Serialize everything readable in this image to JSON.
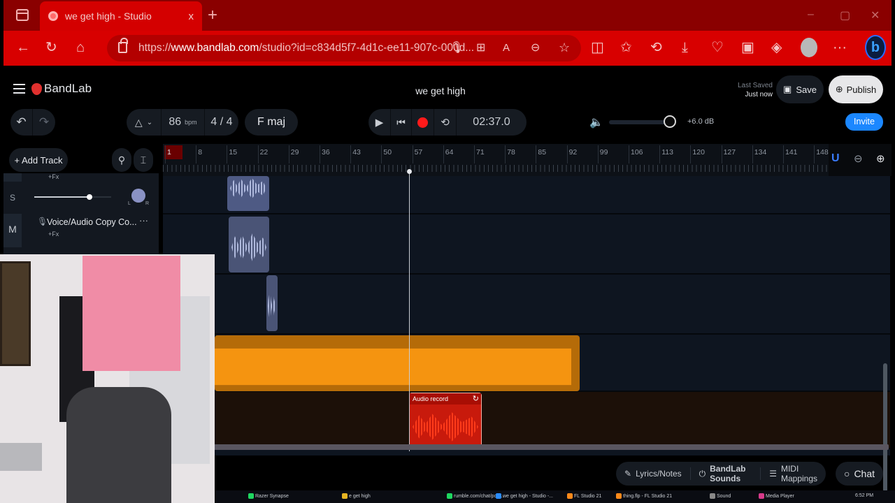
{
  "browser": {
    "tab_title": "we get high - Studio",
    "tab_close": "x",
    "new_tab": "+",
    "url_prefix": "https://",
    "url_host": "www.bandlab.com",
    "url_path": "/studio?id=c834d5f7-4d1c-ee11-907c-000d...",
    "window_controls": [
      "–",
      "▢",
      "✕"
    ],
    "nav_icons": [
      "back-icon",
      "refresh-icon",
      "home-icon"
    ],
    "toolbar_icons": [
      "microphone-icon",
      "apps-icon",
      "read-aloud-icon",
      "zoom-out-icon",
      "favorite-star-icon",
      "split-screen-icon",
      "favorites-icon",
      "history-icon",
      "downloads-icon",
      "browser-essentials-icon",
      "math-solver-icon",
      "screenshot-icon",
      "profile-avatar",
      "more-icon",
      "bing-copilot-icon"
    ]
  },
  "app": {
    "brand": "BandLab",
    "project_title": "we get high",
    "last_saved_label": "Last Saved",
    "last_saved_value": "Just now",
    "save_label": "Save",
    "publish_label": "Publish",
    "invite_label": "Invite",
    "tempo": "86",
    "tempo_unit": "bpm",
    "time_signature": "4 / 4",
    "key": "F maj",
    "time_display": "02:37.0",
    "volume_db": "+6.0 dB",
    "volume_level": 0.95,
    "add_track_label": "+ Add Track"
  },
  "ruler": {
    "bars": [
      "1",
      "8",
      "15",
      "22",
      "29",
      "36",
      "43",
      "50",
      "57",
      "64",
      "71",
      "78",
      "85",
      "92",
      "99",
      "106",
      "113",
      "120",
      "127",
      "134",
      "141",
      "148"
    ],
    "playhead_bar": 57
  },
  "tracks": [
    {
      "label": "",
      "fx": "+Fx",
      "solo": "S",
      "pan_left": "L",
      "pan_right": "R",
      "volume_level": 0.75
    },
    {
      "label": "Voice/Audio Copy Co...",
      "fx": "+Fx",
      "mute": "M",
      "more": "···"
    }
  ],
  "clips": [
    {
      "label": "Audio record",
      "color": "#d91f0f"
    }
  ],
  "bottom": {
    "lyrics": "Lyrics/Notes",
    "sounds": "BandLab Sounds",
    "midi": "MIDI Mappings",
    "chat": "Chat"
  },
  "taskbar": {
    "items": [
      "Razer Synapse",
      "e get high",
      "rumble.com/chat/pop...",
      "we get high - Studio -...",
      "FL Studio 21",
      "thing.flp - FL Studio 21",
      "Sound",
      "Media Player"
    ],
    "clock": "6:52 PM"
  },
  "colors": {
    "browser_red": "#d80000",
    "accent_blue": "#1b87ff",
    "record_red": "#ff1a1a",
    "clip_orange": "#f59410",
    "clip_blue": "#7884b8"
  }
}
